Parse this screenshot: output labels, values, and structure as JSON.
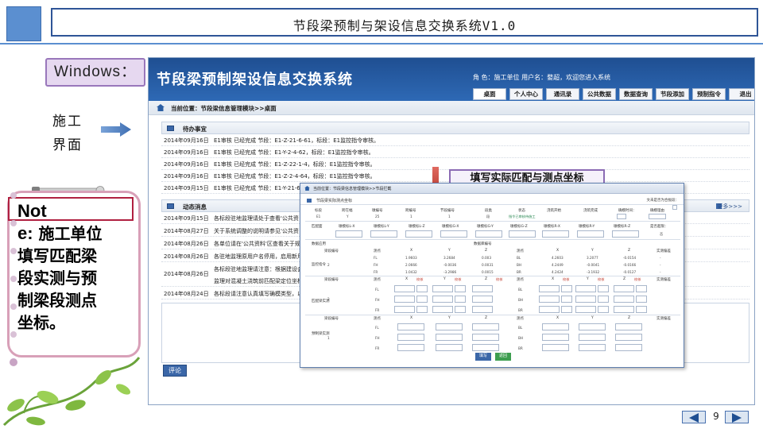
{
  "slide": {
    "title": "节段梁预制与架设信息交换系统V1.0",
    "windows_label": "Windows：",
    "ui_label_line1": "施工",
    "ui_label_line2": "界面",
    "note": {
      "head": "Not",
      "line1_prefix": "e:",
      "line1_rest": " 施工单位",
      "line2": "填写匹配梁",
      "line3": "段实测与预",
      "line4": "制梁段测点",
      "line5": "坐标。"
    },
    "callout": "填写实际匹配与测点坐标",
    "page_number": "9",
    "colors": {
      "accent": "#2f5597",
      "app_header": "#1f4f92",
      "note_border": "#d8a0b8",
      "callout_border": "#8b6bb4"
    }
  },
  "app": {
    "title": "节段梁预制架设信息交换系统",
    "user_line": "角  色：施工单位   用户名：婺超，欢迎您进入系统",
    "nav": [
      {
        "label": "桌面"
      },
      {
        "label": "个人中心"
      },
      {
        "label": "通讯录"
      },
      {
        "label": "公共数据"
      },
      {
        "label": "数据查询"
      },
      {
        "label": "节段添加"
      },
      {
        "label": "预制指令"
      },
      {
        "label": "退出"
      }
    ],
    "breadcrumb": "当前位置：节段梁信息管理模块>>桌面",
    "todo": {
      "title": "待办事宜",
      "rows": [
        {
          "date": "2014年09月16日",
          "text": "E1审核 已经完成 节段：E1-Z-21-6-61，标段：E1监控指令审核。"
        },
        {
          "date": "2014年09月16日",
          "text": "E1审核 已经完成 节段：E1-Y-2-4-62，标段：E1监控指令审核。"
        },
        {
          "date": "2014年09月16日",
          "text": "E1审核 已经完成 节段：E1-Z-22-1-4，标段：E1监控指令审核。"
        },
        {
          "date": "2014年09月16日",
          "text": "E1审核 已经完成 节段：E1-Z-2-4-64，标段：E1监控指令审核。"
        },
        {
          "date": "2014年09月15日",
          "text": "E1审核 已经完成 节段：E1-Y-21-6"
        }
      ]
    },
    "news": {
      "title": "动态消息",
      "more": "更多>>>",
      "rows": [
        {
          "date": "2014年09月15日",
          "text": "各标段驻地监理请处于查看'公共资"
        },
        {
          "date": "2014年08月27日",
          "text": "关于系统调整的说明请参见'公共资"
        },
        {
          "date": "2014年08月26日",
          "text": "各单位请在'公共资料'区查看关于规"
        },
        {
          "date": "2014年08月26日",
          "text": "各驻地监理原用户名停用，启用新用"
        },
        {
          "date": "2014年08月26日",
          "text": "各标段驻地监理请注意：根据建设会",
          "text2": "监理对混凝土浇筑前匹配梁定位坐标"
        },
        {
          "date": "2014年08月24日",
          "text": "各标段请注意认真填写确模类型，以"
        }
      ]
    },
    "comment_button": "评论"
  },
  "dialog": {
    "breadcrumb": "当前位置：节段梁信息管理模块>>节段拦截",
    "subtitle": "节段梁实际测点坐标",
    "right_note": "文未是否为合拢段：",
    "header_labels": [
      "标段",
      "跨在幅",
      "墩编号",
      "跨编号",
      "节段编号",
      "段类",
      "状态",
      "浇筑开始",
      "浇筑完成",
      "确模时间：",
      "确模理由"
    ],
    "header_values": [
      "E1",
      "Y",
      "25",
      "1",
      "1",
      "段",
      "指令已审核待施工"
    ],
    "match_labels": [
      "匹配面",
      "墩模标L-X",
      "墩模标L-Y",
      "墩模标L-Z",
      "墩模标G-X",
      "墩模标G-Y",
      "墩模标G-Z",
      "墩模标R-X",
      "墩模标R-Y",
      "墩模标R-Z",
      "是否超限："
    ],
    "match_flag": "否",
    "section_data": "数据应用",
    "section_monitor": "监控指令",
    "section_match": "匹配梁实测",
    "section_precast": "预制梁实测",
    "data_code": "数据库编号",
    "col_heads": [
      "梁段编号",
      "测点",
      "X",
      "Y",
      "Z",
      "测点",
      "X",
      "Y",
      "Z",
      "实测偏差"
    ],
    "monitor_rows": [
      {
        "seg": "",
        "pt": "FL",
        "x": "1.9603",
        "y": "3.2684",
        "z": "0.003",
        "pt2": "BL",
        "x2": "4.2603",
        "y2": "3.2077",
        "z2": "-0.0154",
        "dev": "-"
      },
      {
        "seg": "2",
        "pt": "FH",
        "x": "2.0666",
        "y": "-0.0036",
        "z": "0.0031",
        "pt2": "BH",
        "x2": "4.2449",
        "y2": "-0.0041",
        "z2": "-0.0166",
        "dev": "-"
      },
      {
        "seg": "",
        "pt": "FR",
        "x": "1.0432",
        "y": "-3.2986",
        "z": "0.0015",
        "pt2": "BR",
        "x2": "4.2424",
        "y2": "-3.1932",
        "z2": "-0.0127",
        "dev": "-"
      }
    ],
    "match_points": [
      "FL",
      "FH",
      "FR"
    ],
    "match_points_b": [
      "BL",
      "BH",
      "BR"
    ],
    "match_seg": "2",
    "precast_seg": "1",
    "calc_label": "校核",
    "ok_button": "填写",
    "back_button": "返回"
  }
}
